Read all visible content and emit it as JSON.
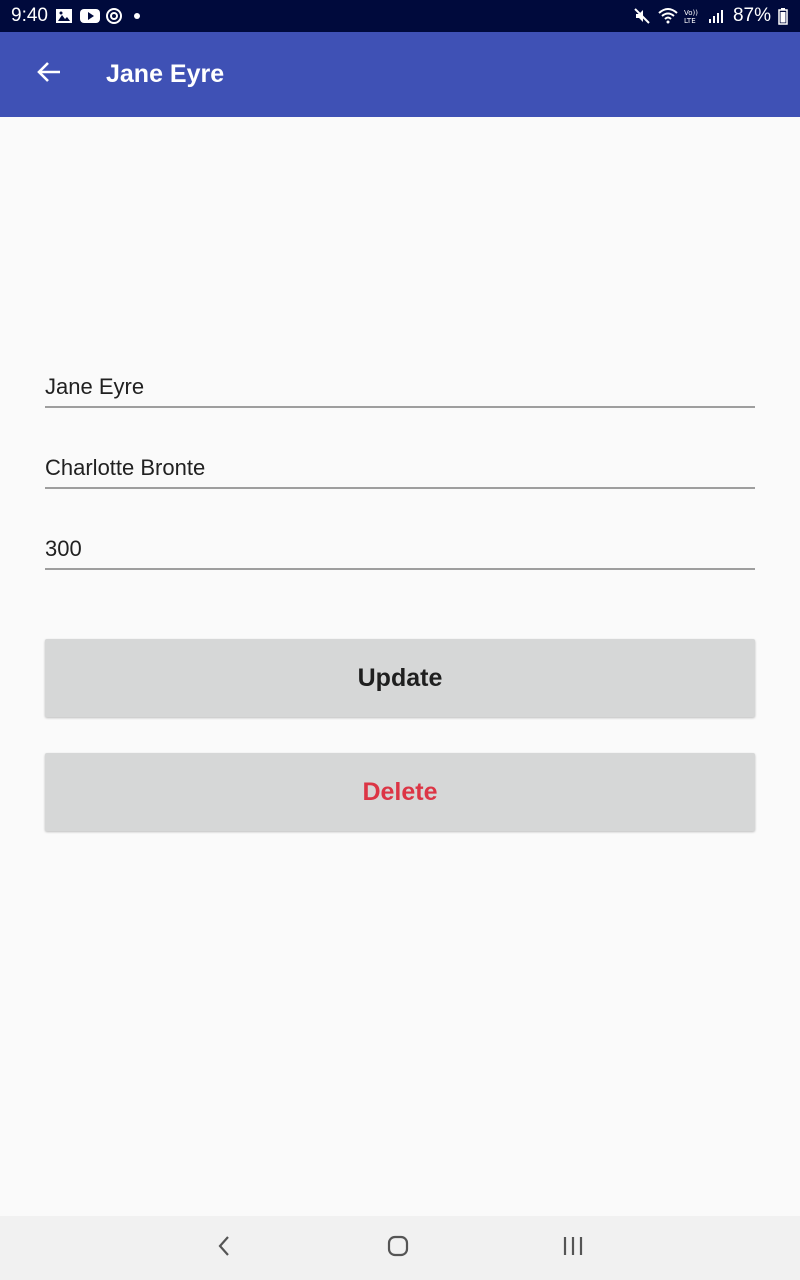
{
  "status_bar": {
    "time": "9:40",
    "battery": "87%",
    "icons": [
      "image-icon",
      "youtube-icon",
      "sync-icon",
      "dot-icon",
      "mute-icon",
      "wifi-icon",
      "volte-icon",
      "signal-icon",
      "battery-icon"
    ]
  },
  "app_bar": {
    "title": "Jane Eyre",
    "color": "#3f51b5"
  },
  "form": {
    "title_value": "Jane Eyre",
    "author_value": "Charlotte Bronte",
    "pages_value": "300"
  },
  "buttons": {
    "update_label": "Update",
    "delete_label": "Delete",
    "delete_color": "#dc3545"
  },
  "nav_bar": {
    "icons": [
      "nav-back-icon",
      "nav-home-icon",
      "nav-recents-icon"
    ]
  }
}
